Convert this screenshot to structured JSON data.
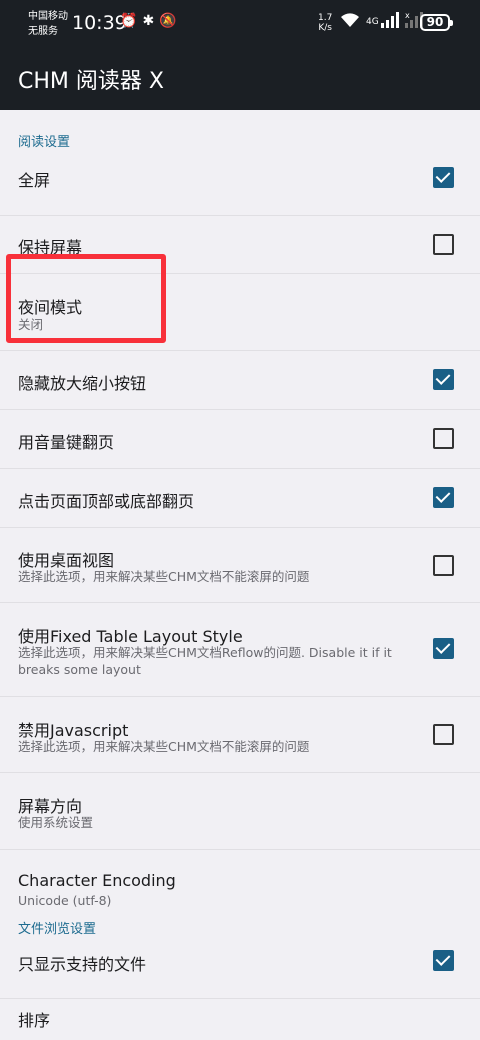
{
  "status_bar": {
    "carrier_line1": "中国移动",
    "carrier_line2": "无服务",
    "time": "10:39",
    "net_speed_value": "1.7",
    "net_speed_unit": "K/s",
    "network_type": "4G",
    "battery": "90"
  },
  "app": {
    "title": "CHM 阅读器 X"
  },
  "sections": {
    "reading": "阅读设置",
    "browsing": "文件浏览设置"
  },
  "settings": [
    {
      "title": "全屏",
      "checked": true
    },
    {
      "title": "保持屏幕",
      "checked": false
    },
    {
      "title": "夜间模式",
      "subtitle": "关闭"
    },
    {
      "title": "隐藏放大缩小按钮",
      "checked": true
    },
    {
      "title": "用音量键翻页",
      "checked": false
    },
    {
      "title": "点击页面顶部或底部翻页",
      "checked": true
    },
    {
      "title": "使用桌面视图",
      "subtitle": "选择此选项，用来解决某些CHM文档不能滚屏的问题",
      "checked": false
    },
    {
      "title": "使用Fixed Table Layout Style",
      "subtitle": "选择此选项，用来解决某些CHM文档Reflow的问题. Disable it if it breaks some layout",
      "checked": true
    },
    {
      "title": "禁用Javascript",
      "subtitle": "选择此选项，用来解决某些CHM文档不能滚屏的问题",
      "checked": false
    },
    {
      "title": "屏幕方向",
      "subtitle": "使用系统设置"
    },
    {
      "title": "Character Encoding",
      "subtitle": "Unicode (utf-8)"
    }
  ],
  "browse_settings": [
    {
      "title": "只显示支持的文件",
      "checked": true
    },
    {
      "title": "排序"
    }
  ],
  "colors": {
    "accent": "#1a5f86",
    "toolbar": "#1b1f24",
    "section": "#1d6b8f",
    "highlight": "#f8303a"
  }
}
